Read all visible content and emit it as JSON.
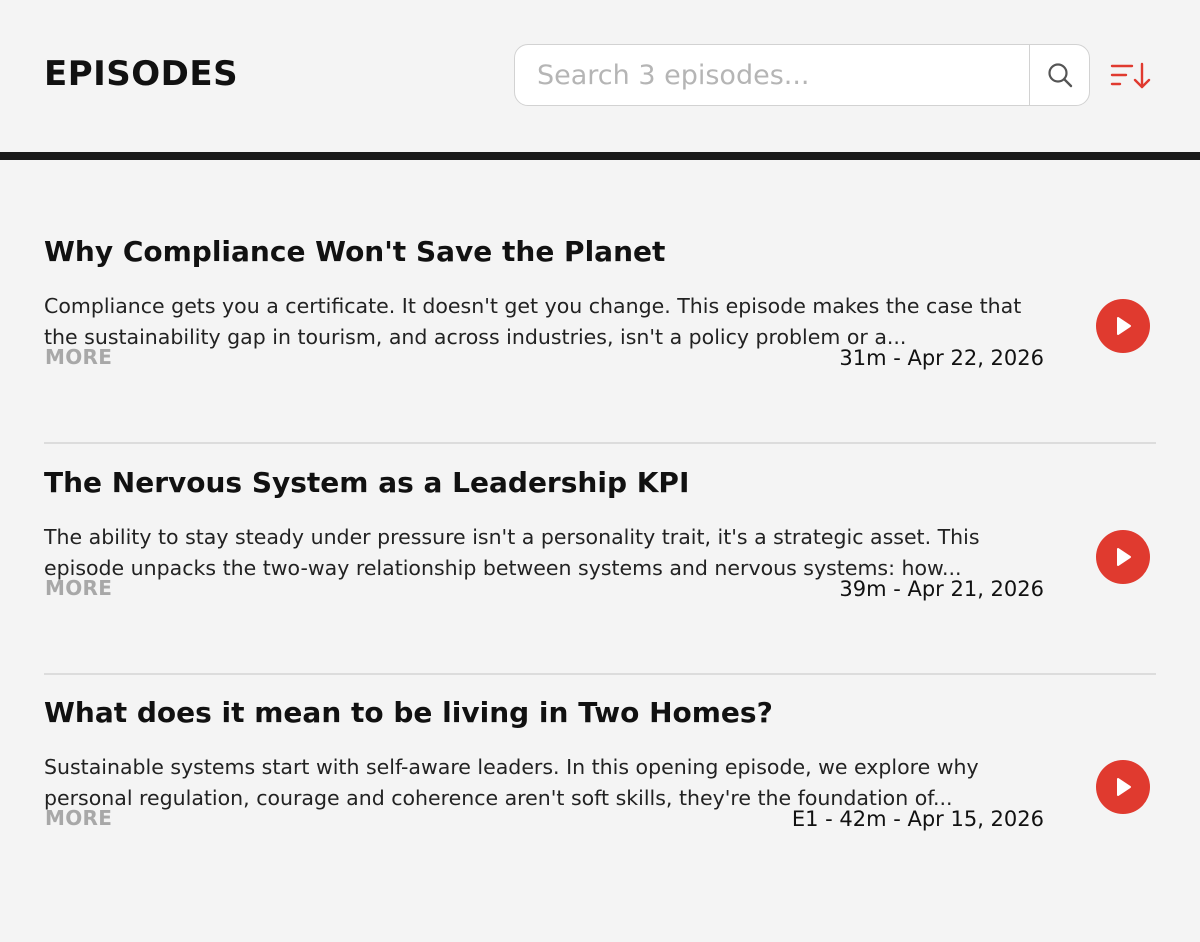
{
  "header": {
    "title": "EPISODES",
    "search_placeholder": "Search 3 episodes...",
    "search_icon": "search-icon",
    "sort_icon": "sort-descending-icon"
  },
  "colors": {
    "accent": "#e03a2f",
    "divider": "#1a1a1a",
    "more_text": "#a8a8a8"
  },
  "episodes": [
    {
      "title": "Why Compliance Won't Save the Planet",
      "description": "Compliance gets you a certificate. It doesn't get you change. This episode makes the case that the sustainability gap in tourism, and across industries, isn't a policy problem or a...",
      "more_label": "MORE",
      "meta": "31m - Apr 22, 2026",
      "play_icon": "play-icon"
    },
    {
      "title": "The Nervous System as a Leadership KPI",
      "description": "The ability to stay steady under pressure isn't a personality trait, it's a strategic asset. This episode unpacks the two-way relationship between systems and nervous systems: how...",
      "more_label": "MORE",
      "meta": "39m - Apr 21, 2026",
      "play_icon": "play-icon"
    },
    {
      "title": "What does it mean to be living in Two Homes?",
      "description": "Sustainable systems start with self-aware leaders. In this opening episode, we explore why personal regulation, courage and coherence aren't soft skills, they're the foundation of...",
      "more_label": "MORE",
      "meta": "E1 - 42m - Apr 15, 2026",
      "play_icon": "play-icon"
    }
  ]
}
